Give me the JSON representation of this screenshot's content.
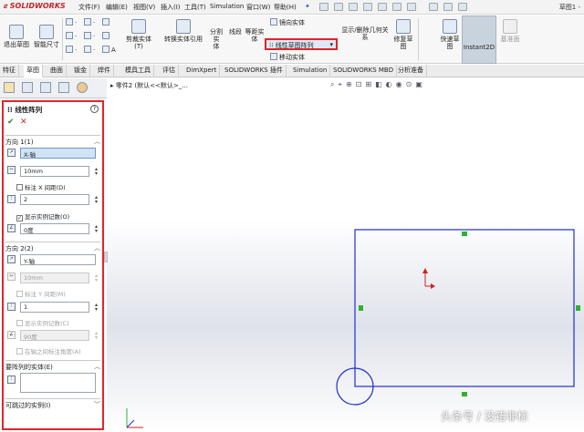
{
  "app": {
    "logo_text": "SOLIDWORKS",
    "document_title": "草图1 -"
  },
  "menu": [
    "文件(F)",
    "编辑(E)",
    "视图(V)",
    "插入(I)",
    "工具(T)",
    "Simulation",
    "窗口(W)",
    "帮助(H)"
  ],
  "ribbon": {
    "exit_sketch": "退出草图",
    "smart_dimension": "智能尺寸",
    "trim": "剪裁实体(T)",
    "convert": "转换实体引用",
    "offset": "等距实体",
    "offset_surface": "等距实",
    "offset_suffix": "体",
    "split": "分割实",
    "split_suffix": "体",
    "line": "线段",
    "mirror": "镜向实体",
    "linear_pattern": "线性草图阵列",
    "move": "移动实体",
    "relations": "显示/删除几何关系",
    "repair": "修复草",
    "repair_suffix": "图",
    "quick_snap": "快速草",
    "quick_snap_suffix": "图",
    "instant2d": "Instant2D",
    "shaded": "基准面"
  },
  "tabs": [
    "特征",
    "草图",
    "曲面",
    "钣金",
    "焊件",
    "模具工具",
    "评估",
    "DimXpert",
    "SOLIDWORKS 插件",
    "Simulation",
    "SOLIDWORKS MBD",
    "分析准备"
  ],
  "active_tab": "草图",
  "breadcrumb": "零件2 (默认<<默认>_...",
  "panel": {
    "title": "线性阵列",
    "dir1": {
      "header": "方向 1(1)",
      "axis": "X-轴",
      "spacing": "10mm",
      "dim_spacing": "标注 X 间距(D)",
      "count": "2",
      "show_count": "显示实例记数(O)",
      "angle": "0度"
    },
    "dir2": {
      "header": "方向 2(2)",
      "axis": "Y-轴",
      "spacing": "10mm",
      "dim_spacing": "标注 Y 间距(M)",
      "count": "1",
      "show_count": "显示实例记数(C)",
      "angle": "90度",
      "dim_angle": "在轴之间标注角度(A)"
    },
    "bodies": {
      "header": "要阵列的实体(E)"
    },
    "skip": {
      "header": "可跳过的实例(I)"
    }
  },
  "watermark": "头条号 / 没错非标",
  "colors": {
    "accent": "#e0242c",
    "sketch": "#1f2fcc",
    "point": "#2bb32b"
  }
}
